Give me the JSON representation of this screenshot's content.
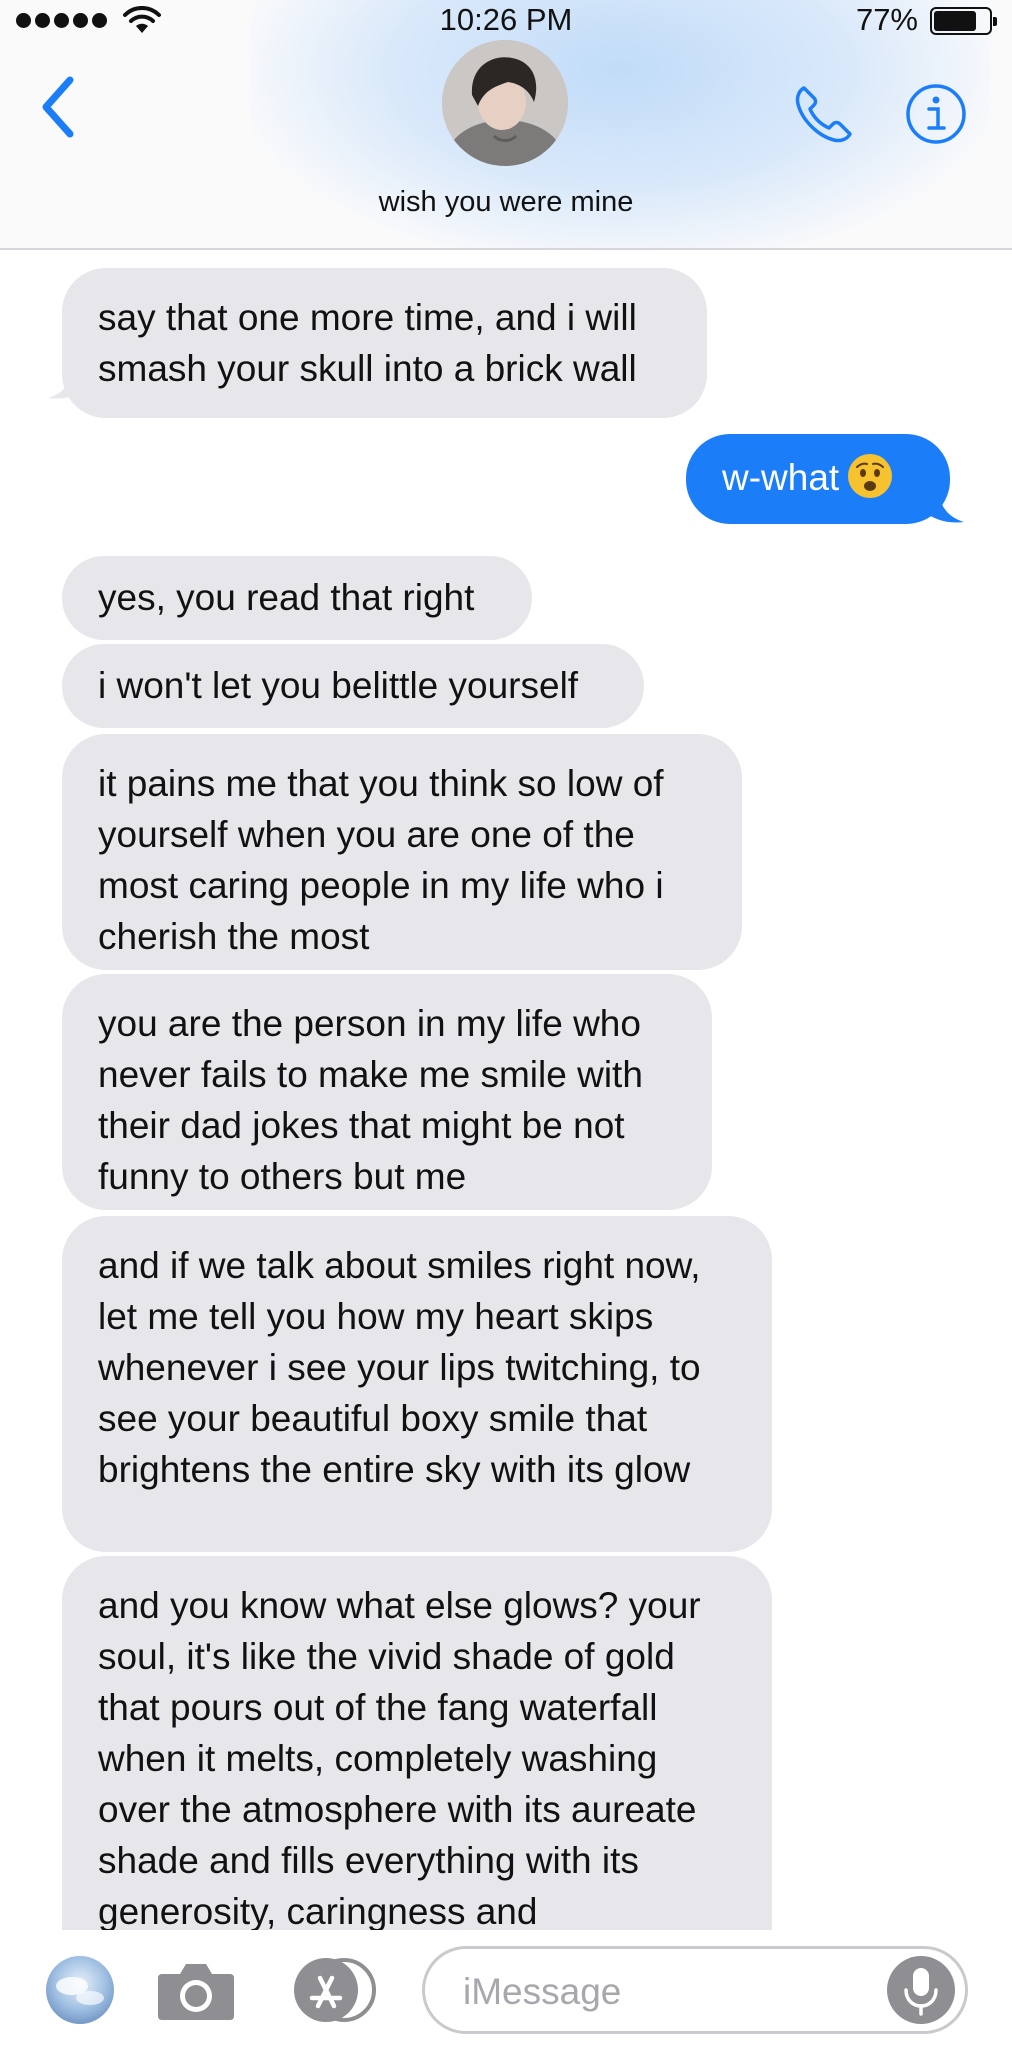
{
  "status_bar": {
    "time": "10:26 PM",
    "battery_percent_label": "77%",
    "battery_level": 0.77,
    "signal_bars": 5
  },
  "header": {
    "contact_name": "wish you were mine",
    "back_icon": "chevron-left-icon",
    "call_icon": "phone-icon",
    "info_icon": "info-icon",
    "accent_color": "#1b7ef8"
  },
  "messages": [
    {
      "direction": "incoming",
      "text": "say that one more time, and i will smash your skull into a brick wall"
    },
    {
      "direction": "outgoing",
      "text": "w-what",
      "emoji": "anguished-face"
    },
    {
      "direction": "incoming",
      "text": "yes, you read that right"
    },
    {
      "direction": "incoming",
      "text": "i won't let you belittle yourself"
    },
    {
      "direction": "incoming",
      "text": "it pains me that you think so low of yourself when you are one of the most caring people in my life who i cherish the most"
    },
    {
      "direction": "incoming",
      "text": "you are the person in my life who never fails to make me smile with their dad jokes that might be not funny to others but me"
    },
    {
      "direction": "incoming",
      "text": "and if we talk about smiles right now, let me tell you how my heart skips whenever i see your lips twitching, to see your beautiful boxy smile that brightens the entire sky with its glow"
    },
    {
      "direction": "incoming",
      "text": "and you know what else glows? your soul, it's like the vivid shade of gold that pours out of the fang waterfall when it melts, completely washing over the atmosphere with its aureate shade and fills everything with its generosity, caringness and"
    }
  ],
  "input_bar": {
    "placeholder": "iMessage",
    "photos_icon": "photos-app-icon",
    "camera_icon": "camera-icon",
    "appstore_icon": "app-store-icon",
    "mic_icon": "microphone-icon"
  }
}
